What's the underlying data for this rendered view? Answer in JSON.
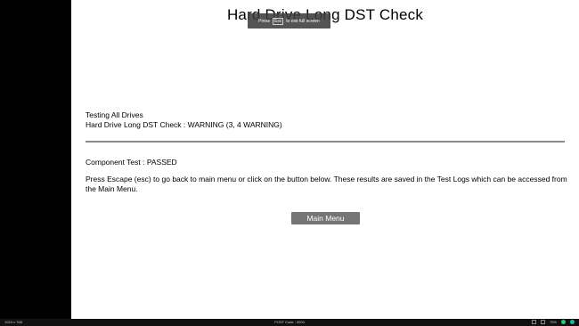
{
  "window": {
    "title": "Hard Drive Long DST Check"
  },
  "toast": {
    "prefix": "Press",
    "key": "Esc",
    "suffix": "to exit full screen"
  },
  "status": {
    "line1": "Testing All Drives",
    "line2": "Hard Drive Long DST Check : WARNING (3, 4 WARNING)"
  },
  "component_test": "Component Test : PASSED",
  "instructions": "Press Escape (esc) to go back to main menu or click on the button below. These results are saved in the Test Logs which can be accessed from the Main Menu.",
  "buttons": {
    "main_menu": "Main Menu"
  },
  "bottom_bar": {
    "resolution": "1024 x 768",
    "post_code": "POST Code : 0000",
    "zoom": "75%",
    "status_colors": [
      "#2ecc71",
      "#1abc9c"
    ]
  },
  "colors": {
    "panel_bg": "#ffffff",
    "button_bg": "#757575",
    "divider": "#8a8a8a"
  }
}
